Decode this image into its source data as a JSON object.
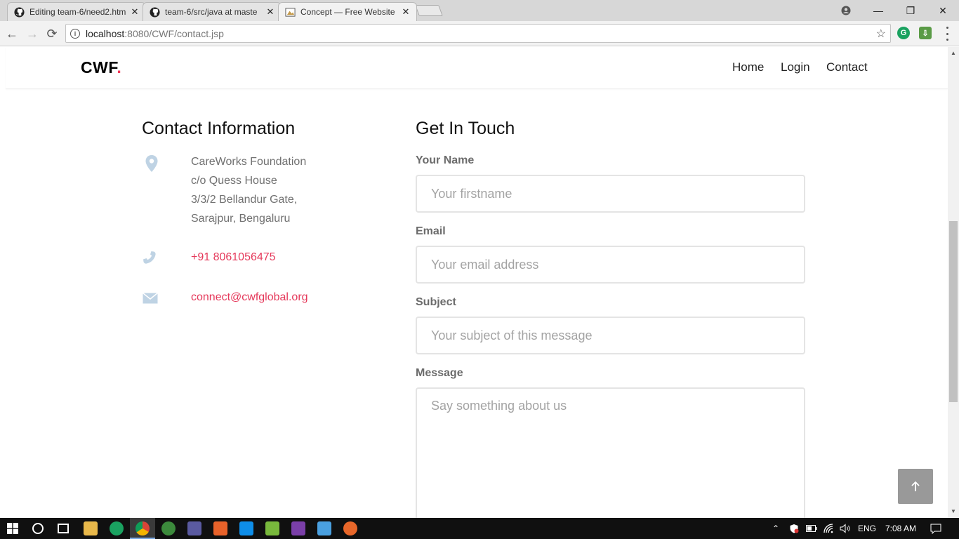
{
  "browser": {
    "tabs": [
      {
        "title": "Editing team-6/need2.htm",
        "icon": "github-icon"
      },
      {
        "title": "team-6/src/java at maste",
        "icon": "github-icon"
      },
      {
        "title": "Concept — Free Website",
        "icon": "site-favicon"
      }
    ],
    "url_host": "localhost",
    "url_path": ":8080/CWF/contact.jsp"
  },
  "site": {
    "logo": "CWF",
    "logo_dot": ".",
    "nav": [
      "Home",
      "Login",
      "Contact"
    ]
  },
  "contact_info": {
    "heading": "Contact Information",
    "address_lines": [
      "CareWorks Foundation",
      "c/o Quess House",
      "3/3/2 Bellandur Gate,",
      "Sarajpur, Bengaluru"
    ],
    "phone": "+91 8061056475",
    "email": "connect@cwfglobal.org"
  },
  "form": {
    "heading": "Get In Touch",
    "name_label": "Your Name",
    "name_placeholder": "Your firstname",
    "email_label": "Email",
    "email_placeholder": "Your email address",
    "subject_label": "Subject",
    "subject_placeholder": "Your subject of this message",
    "message_label": "Message",
    "message_placeholder": "Say something about us"
  },
  "taskbar": {
    "language": "ENG",
    "time": "7:08 AM"
  },
  "colors": {
    "accent": "#e5385a",
    "logo_dot": "#f23a5a",
    "label": "#6b6b6b"
  }
}
